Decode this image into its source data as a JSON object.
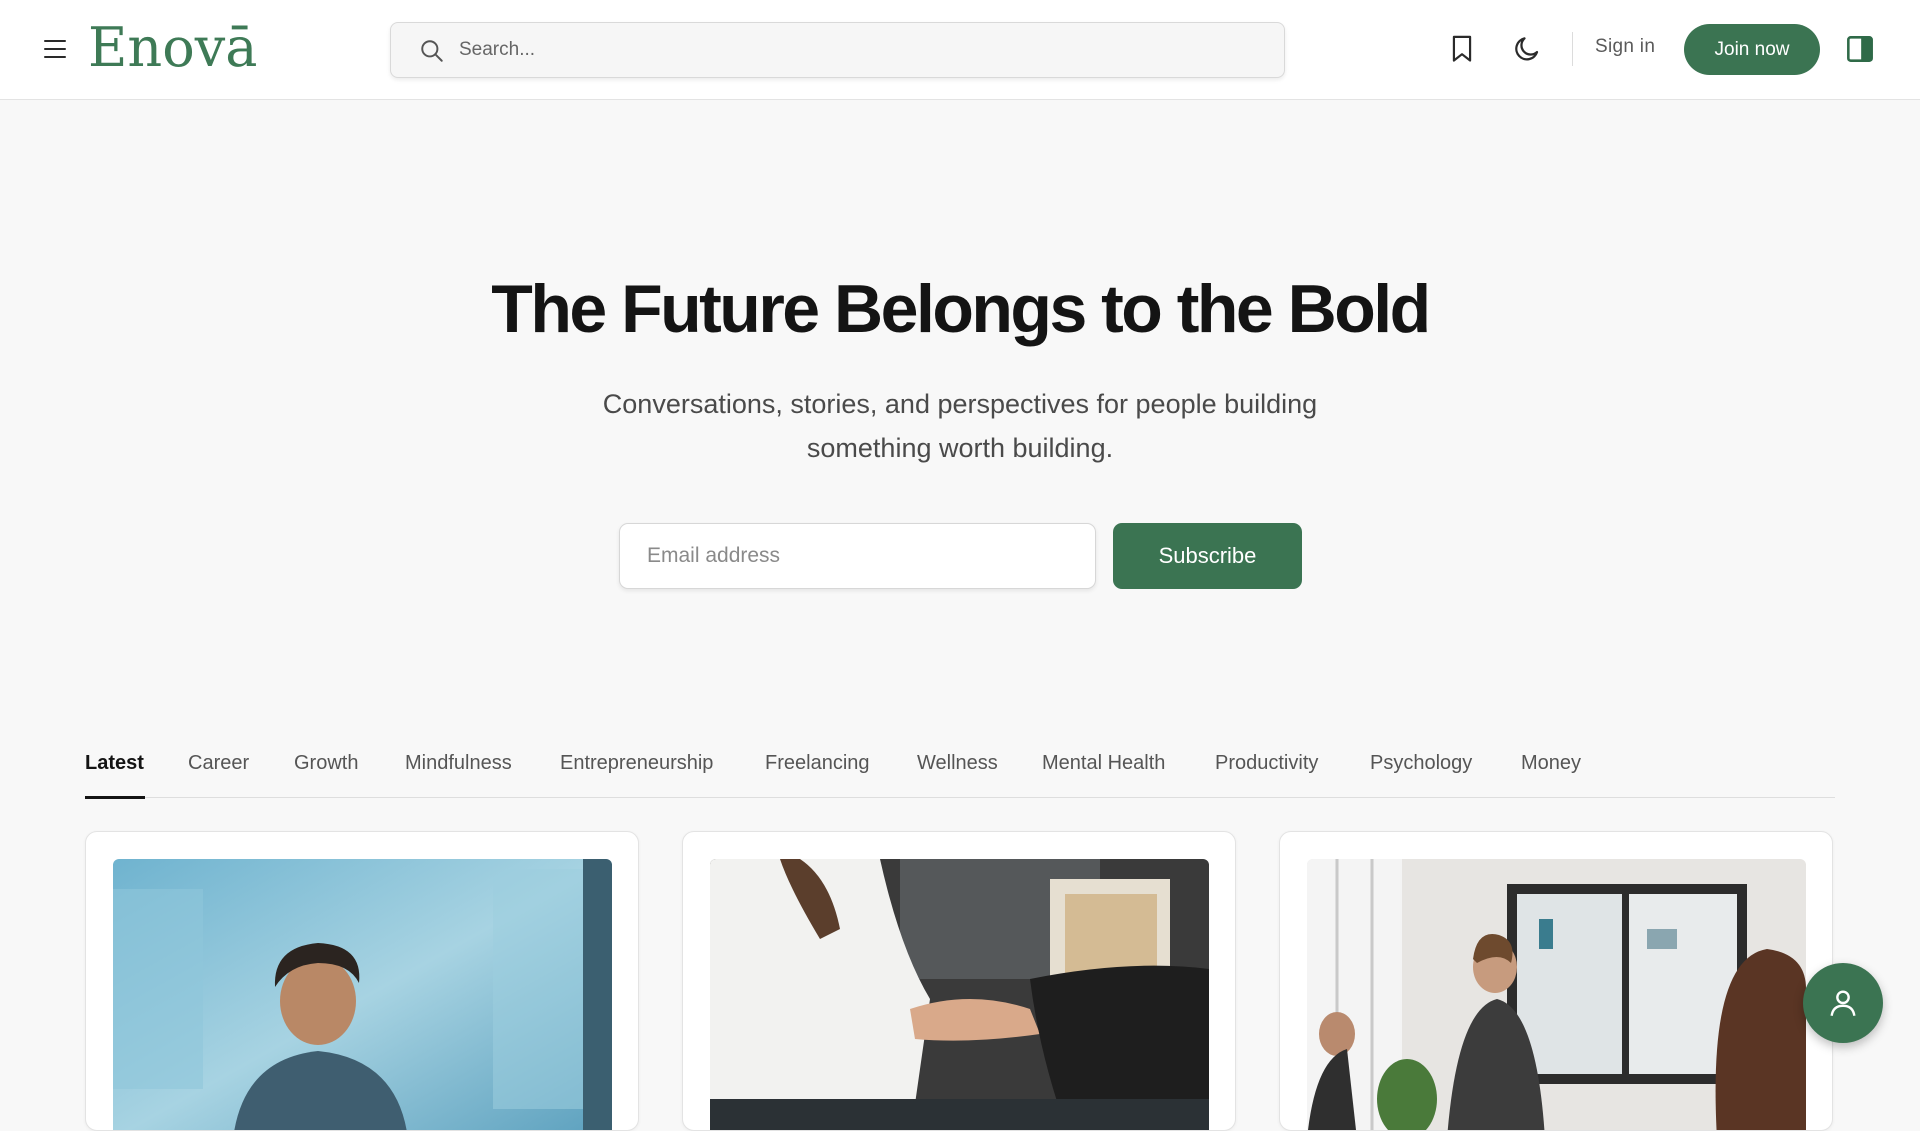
{
  "header": {
    "logo_text": "Enovā",
    "search_placeholder": "Search...",
    "signin_label": "Sign in",
    "join_label": "Join now"
  },
  "hero": {
    "title": "The Future Belongs to the Bold",
    "subtitle": "Conversations, stories, and perspectives for people building something worth building.",
    "email_placeholder": "Email address",
    "subscribe_label": "Subscribe"
  },
  "tabs": [
    {
      "label": "Latest",
      "active": true
    },
    {
      "label": "Career"
    },
    {
      "label": "Growth"
    },
    {
      "label": "Mindfulness"
    },
    {
      "label": "Entrepreneurship"
    },
    {
      "label": "Freelancing"
    },
    {
      "label": "Wellness"
    },
    {
      "label": "Mental Health"
    },
    {
      "label": "Productivity"
    },
    {
      "label": "Psychology"
    },
    {
      "label": "Money"
    }
  ],
  "cards": [
    {
      "image": "man-portrait-blue-background"
    },
    {
      "image": "business-handshake"
    },
    {
      "image": "women-whiteboard-presentation"
    }
  ],
  "colors": {
    "brand": "#3b7452",
    "logo": "#3e7a56",
    "background": "#f8f8f8"
  },
  "icons": [
    "menu-icon",
    "search-icon",
    "bookmark-icon",
    "moon-icon",
    "sidebar-panel-icon",
    "user-icon"
  ]
}
